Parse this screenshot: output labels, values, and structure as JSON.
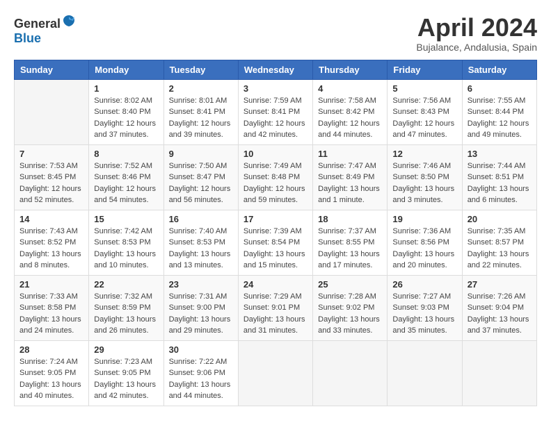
{
  "header": {
    "logo_general": "General",
    "logo_blue": "Blue",
    "month": "April 2024",
    "location": "Bujalance, Andalusia, Spain"
  },
  "weekdays": [
    "Sunday",
    "Monday",
    "Tuesday",
    "Wednesday",
    "Thursday",
    "Friday",
    "Saturday"
  ],
  "weeks": [
    [
      {
        "day": "",
        "info": ""
      },
      {
        "day": "1",
        "info": "Sunrise: 8:02 AM\nSunset: 8:40 PM\nDaylight: 12 hours\nand 37 minutes."
      },
      {
        "day": "2",
        "info": "Sunrise: 8:01 AM\nSunset: 8:41 PM\nDaylight: 12 hours\nand 39 minutes."
      },
      {
        "day": "3",
        "info": "Sunrise: 7:59 AM\nSunset: 8:41 PM\nDaylight: 12 hours\nand 42 minutes."
      },
      {
        "day": "4",
        "info": "Sunrise: 7:58 AM\nSunset: 8:42 PM\nDaylight: 12 hours\nand 44 minutes."
      },
      {
        "day": "5",
        "info": "Sunrise: 7:56 AM\nSunset: 8:43 PM\nDaylight: 12 hours\nand 47 minutes."
      },
      {
        "day": "6",
        "info": "Sunrise: 7:55 AM\nSunset: 8:44 PM\nDaylight: 12 hours\nand 49 minutes."
      }
    ],
    [
      {
        "day": "7",
        "info": "Sunrise: 7:53 AM\nSunset: 8:45 PM\nDaylight: 12 hours\nand 52 minutes."
      },
      {
        "day": "8",
        "info": "Sunrise: 7:52 AM\nSunset: 8:46 PM\nDaylight: 12 hours\nand 54 minutes."
      },
      {
        "day": "9",
        "info": "Sunrise: 7:50 AM\nSunset: 8:47 PM\nDaylight: 12 hours\nand 56 minutes."
      },
      {
        "day": "10",
        "info": "Sunrise: 7:49 AM\nSunset: 8:48 PM\nDaylight: 12 hours\nand 59 minutes."
      },
      {
        "day": "11",
        "info": "Sunrise: 7:47 AM\nSunset: 8:49 PM\nDaylight: 13 hours\nand 1 minute."
      },
      {
        "day": "12",
        "info": "Sunrise: 7:46 AM\nSunset: 8:50 PM\nDaylight: 13 hours\nand 3 minutes."
      },
      {
        "day": "13",
        "info": "Sunrise: 7:44 AM\nSunset: 8:51 PM\nDaylight: 13 hours\nand 6 minutes."
      }
    ],
    [
      {
        "day": "14",
        "info": "Sunrise: 7:43 AM\nSunset: 8:52 PM\nDaylight: 13 hours\nand 8 minutes."
      },
      {
        "day": "15",
        "info": "Sunrise: 7:42 AM\nSunset: 8:53 PM\nDaylight: 13 hours\nand 10 minutes."
      },
      {
        "day": "16",
        "info": "Sunrise: 7:40 AM\nSunset: 8:53 PM\nDaylight: 13 hours\nand 13 minutes."
      },
      {
        "day": "17",
        "info": "Sunrise: 7:39 AM\nSunset: 8:54 PM\nDaylight: 13 hours\nand 15 minutes."
      },
      {
        "day": "18",
        "info": "Sunrise: 7:37 AM\nSunset: 8:55 PM\nDaylight: 13 hours\nand 17 minutes."
      },
      {
        "day": "19",
        "info": "Sunrise: 7:36 AM\nSunset: 8:56 PM\nDaylight: 13 hours\nand 20 minutes."
      },
      {
        "day": "20",
        "info": "Sunrise: 7:35 AM\nSunset: 8:57 PM\nDaylight: 13 hours\nand 22 minutes."
      }
    ],
    [
      {
        "day": "21",
        "info": "Sunrise: 7:33 AM\nSunset: 8:58 PM\nDaylight: 13 hours\nand 24 minutes."
      },
      {
        "day": "22",
        "info": "Sunrise: 7:32 AM\nSunset: 8:59 PM\nDaylight: 13 hours\nand 26 minutes."
      },
      {
        "day": "23",
        "info": "Sunrise: 7:31 AM\nSunset: 9:00 PM\nDaylight: 13 hours\nand 29 minutes."
      },
      {
        "day": "24",
        "info": "Sunrise: 7:29 AM\nSunset: 9:01 PM\nDaylight: 13 hours\nand 31 minutes."
      },
      {
        "day": "25",
        "info": "Sunrise: 7:28 AM\nSunset: 9:02 PM\nDaylight: 13 hours\nand 33 minutes."
      },
      {
        "day": "26",
        "info": "Sunrise: 7:27 AM\nSunset: 9:03 PM\nDaylight: 13 hours\nand 35 minutes."
      },
      {
        "day": "27",
        "info": "Sunrise: 7:26 AM\nSunset: 9:04 PM\nDaylight: 13 hours\nand 37 minutes."
      }
    ],
    [
      {
        "day": "28",
        "info": "Sunrise: 7:24 AM\nSunset: 9:05 PM\nDaylight: 13 hours\nand 40 minutes."
      },
      {
        "day": "29",
        "info": "Sunrise: 7:23 AM\nSunset: 9:05 PM\nDaylight: 13 hours\nand 42 minutes."
      },
      {
        "day": "30",
        "info": "Sunrise: 7:22 AM\nSunset: 9:06 PM\nDaylight: 13 hours\nand 44 minutes."
      },
      {
        "day": "",
        "info": ""
      },
      {
        "day": "",
        "info": ""
      },
      {
        "day": "",
        "info": ""
      },
      {
        "day": "",
        "info": ""
      }
    ]
  ]
}
